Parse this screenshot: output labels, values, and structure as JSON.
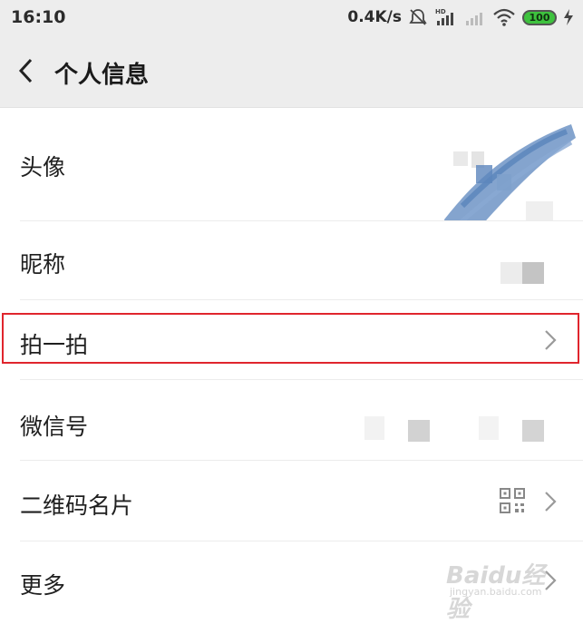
{
  "status_bar": {
    "time": "16:10",
    "net_speed": "0.4K/s",
    "battery": "100",
    "icons": [
      "mute-icon",
      "signal-hd-icon",
      "signal-icon",
      "wifi-icon",
      "battery-icon",
      "charging-icon"
    ]
  },
  "header": {
    "back_icon": "chevron-left-icon",
    "title": "个人信息"
  },
  "rows": [
    {
      "label": "头像",
      "value_type": "blurred-avatar"
    },
    {
      "label": "昵称",
      "value_type": "blurred-text"
    },
    {
      "label": "拍一拍",
      "value_type": "chevron",
      "highlighted": true
    },
    {
      "label": "微信号",
      "value_type": "blurred-text"
    },
    {
      "label": "二维码名片",
      "value_type": "qr-icon-chevron"
    },
    {
      "label": "更多",
      "value_type": "chevron"
    }
  ],
  "colors": {
    "header_bg": "#ededed",
    "highlight_border": "#e0252d",
    "battery": "#3ec23e"
  },
  "watermark": {
    "main": "Baidu经验",
    "sub": "jingyan.baidu.com"
  }
}
